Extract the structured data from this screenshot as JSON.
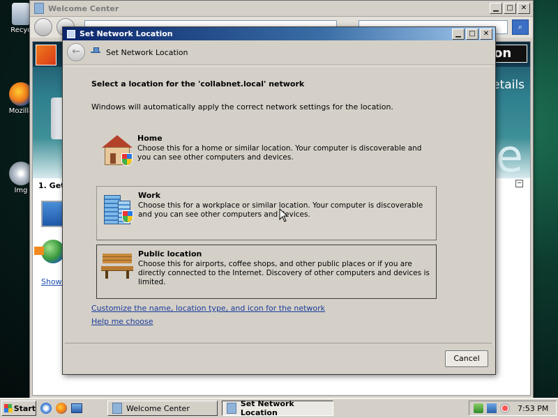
{
  "desktop": {
    "icons": [
      {
        "label": "Recyc"
      },
      {
        "label": "Mozilla"
      },
      {
        "label": "Img"
      }
    ]
  },
  "welcome_window": {
    "title": "Welcome Center",
    "banner_button": "on",
    "banner_details": "etails",
    "banner_letter": "e",
    "section_title": "1. Get",
    "show_link": "Show a"
  },
  "dialog": {
    "title": "Set Network Location",
    "header_title": "Set Network Location",
    "heading": "Select a location for the 'collabnet.local' network",
    "description": "Windows will automatically apply the correct network settings for the location.",
    "options": [
      {
        "title": "Home",
        "description": "Choose this for a home or similar location. Your computer is discoverable and you can see other computers and devices.",
        "icon": "house-icon"
      },
      {
        "title": "Work",
        "description": "Choose this for a workplace or similar location. Your computer is discoverable and you can see other computers and devices.",
        "icon": "building-icon"
      },
      {
        "title": "Public location",
        "description": "Choose this for airports, coffee shops, and other public places or if you are directly connected to the Internet. Discovery of other computers and devices is limited.",
        "icon": "bench-icon"
      }
    ],
    "link_customize": "Customize the name, location type, and icon for the network",
    "link_help": "Help me choose",
    "cancel_label": "Cancel"
  },
  "taskbar": {
    "start_label": "Start",
    "tasks": [
      {
        "label": "Welcome Center",
        "active": false
      },
      {
        "label": "Set Network Location",
        "active": true
      }
    ],
    "clock": "7:53 PM"
  },
  "colors": {
    "titlebar_active": "#0a246a",
    "link": "#1a3a9a",
    "window_face": "#d4d0c8"
  }
}
